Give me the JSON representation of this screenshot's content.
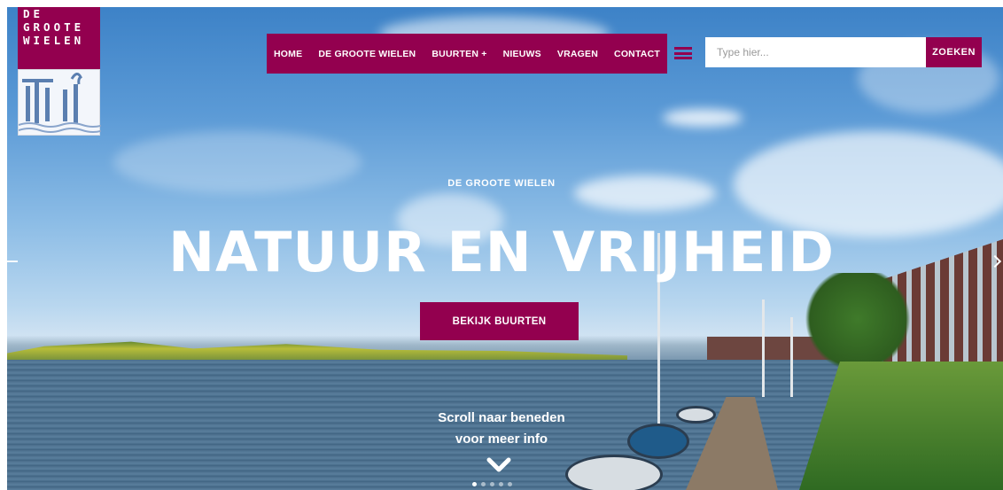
{
  "logo": {
    "lines": [
      "DE",
      "GROOTE",
      "WIELEN"
    ]
  },
  "nav": {
    "items": [
      {
        "label": "HOME"
      },
      {
        "label": "DE GROOTE WIELEN"
      },
      {
        "label": "BUURTEN +"
      },
      {
        "label": "NIEUWS"
      },
      {
        "label": "VRAGEN"
      },
      {
        "label": "CONTACT"
      }
    ]
  },
  "search": {
    "placeholder": "Type hier...",
    "button_label": "ZOEKEN"
  },
  "hero": {
    "kicker": "DE GROOTE WIELEN",
    "headline": "NATUUR EN VRIJHEID",
    "cta_label": "BEKIJK BUURTEN",
    "scroll_line1": "Scroll naar beneden",
    "scroll_line2": "voor meer info"
  },
  "slider": {
    "slide_count": 5,
    "active_index": 0
  },
  "colors": {
    "brand": "#93004f",
    "text_on_brand": "#ffffff"
  },
  "icons": {
    "menu": "hamburger-icon",
    "scroll": "chevron-down-icon",
    "prev": "arrow-left-icon",
    "next": "arrow-right-icon"
  }
}
